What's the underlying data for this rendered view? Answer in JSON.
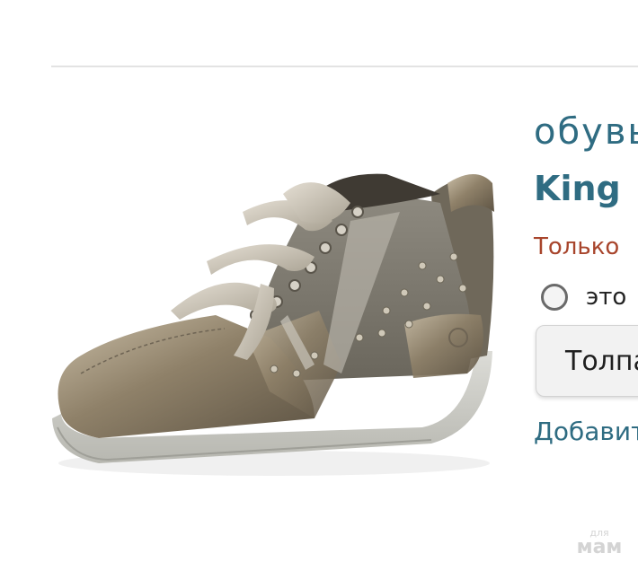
{
  "product": {
    "category_text": "обувь",
    "brand_name": "King",
    "price_text": "Только",
    "gift_label": "это",
    "size_select_value": "Толпа",
    "add_link": "Добавить"
  },
  "watermark": {
    "top": "для",
    "bottom": "мам"
  },
  "colors": {
    "accent": "#2f6c82",
    "price": "#a8452c"
  }
}
